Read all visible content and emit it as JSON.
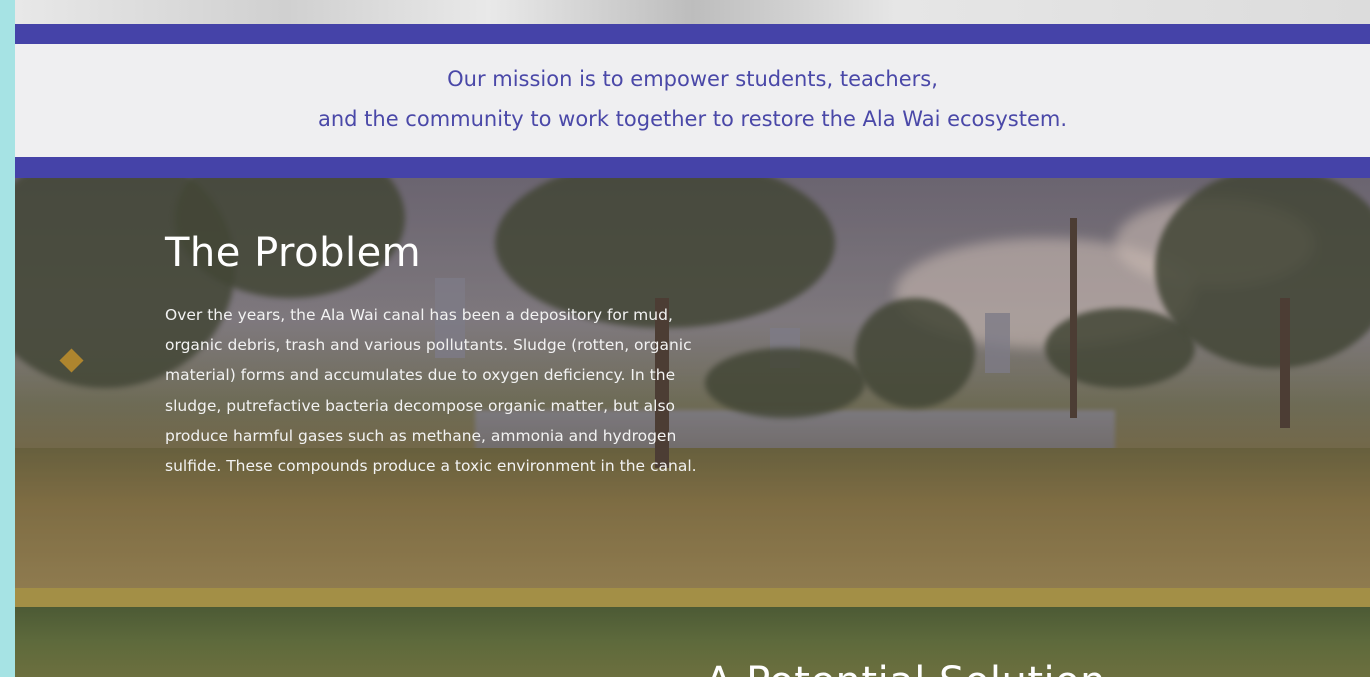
{
  "mission": {
    "line1": "Our mission is to empower students, teachers,",
    "line2": "and the community to work together to restore the Ala Wai ecosystem."
  },
  "problem": {
    "title": "The Problem",
    "body": "Over the years, the Ala Wai canal has been a depository for mud, organic debris, trash and various pollutants.  Sludge (rotten, organic material) forms and accumulates due to oxygen deficiency.  In the sludge, putrefactive bacteria decompose organic matter, but also produce harmful gases such as methane, ammonia and hydrogen sulfide. These compounds produce a toxic environment in the canal."
  },
  "solution": {
    "title": "A Potential Solution"
  },
  "colors": {
    "band": "#4543a8",
    "mission_text": "#4a48a8",
    "gold_band": "#a38f46",
    "outer_bg": "#a6e3e4"
  }
}
